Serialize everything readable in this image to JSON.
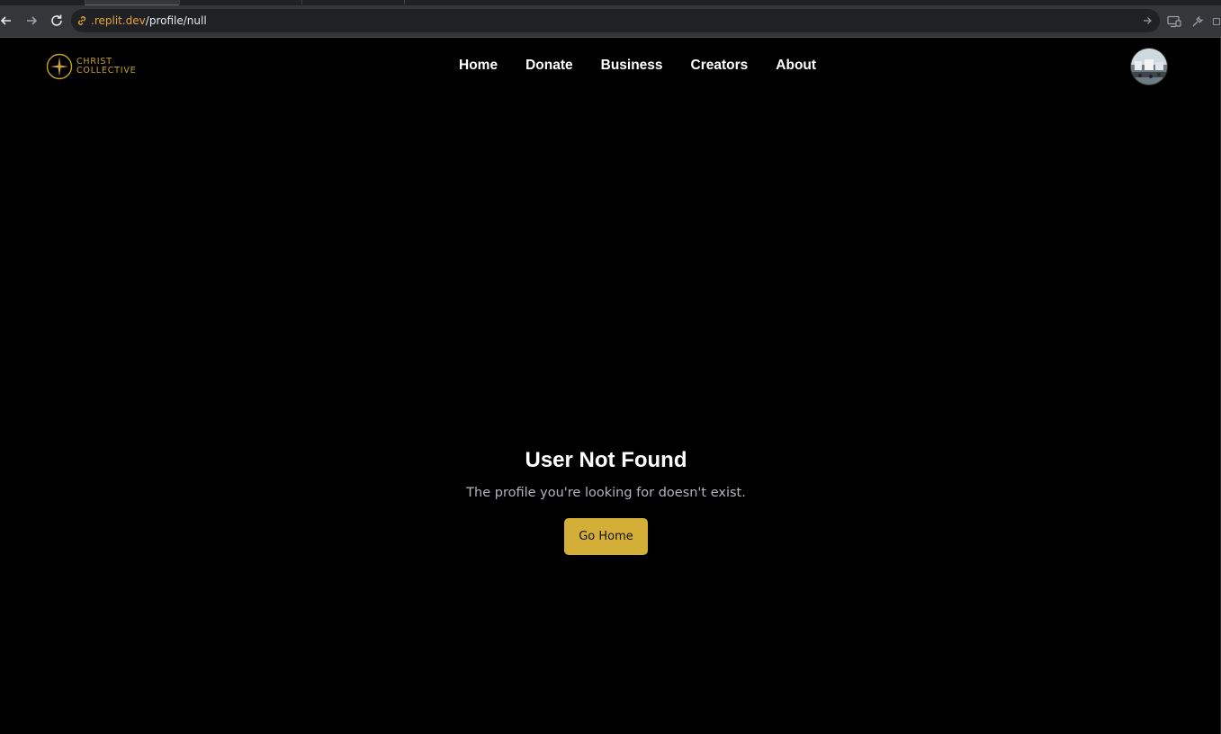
{
  "browser": {
    "url_domain": ".replit.dev",
    "url_path": "/profile/null"
  },
  "site": {
    "logo": {
      "line1": "CHRIST",
      "line2": "COLLECTIVE"
    },
    "nav": [
      "Home",
      "Donate",
      "Business",
      "Creators",
      "About"
    ]
  },
  "not_found": {
    "title": "User Not Found",
    "message": "The profile you're looking for doesn't exist.",
    "button_label": "Go Home"
  },
  "colors": {
    "accent_gold": "#d4af37",
    "logo_gold": "#c9a227",
    "background": "#000000",
    "url_domain": "#e8a43c"
  },
  "icons": {
    "back": "arrow-left-icon",
    "forward": "arrow-right-icon",
    "reload": "reload-icon",
    "site_info": "link-icon",
    "go": "arrow-right-icon",
    "cast": "cast-icon",
    "devtools": "wrench-icon",
    "logo_mark": "star-cross-icon"
  }
}
